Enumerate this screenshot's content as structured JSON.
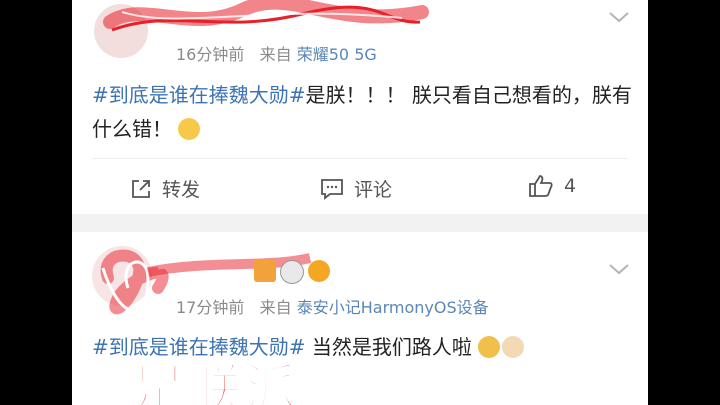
{
  "post1": {
    "time": "16分钟前",
    "from_label": "来自",
    "source": "荣耀50 5G",
    "hashtag": "#到底是谁在捧魏大勋#",
    "body": "是朕！！！ 朕只看自己想看的，朕有什么错！",
    "actions": {
      "repost_label": "转发",
      "comment_label": "评论",
      "like_count": "4"
    }
  },
  "post2": {
    "time": "17分钟前",
    "from_label": "来自",
    "source": "泰安小记HarmonyOS设备",
    "hashtag": "#到底是谁在捧魏大勋#",
    "body": " 当然是我们路人啦"
  },
  "overlay": {
    "text": "是朕派"
  },
  "colors": {
    "link": "#3d73b5",
    "source": "#5a86b8",
    "overlay_red": "#e8181f",
    "scribble_red": "#e8202a"
  }
}
